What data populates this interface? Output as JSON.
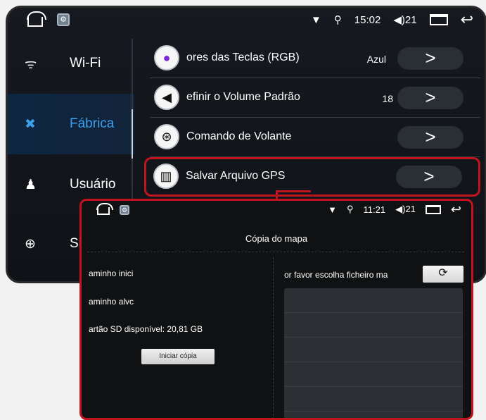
{
  "back_screen": {
    "status": {
      "time": "15:02",
      "volume": "21"
    },
    "sidebar": [
      {
        "label": "Wi-Fi",
        "icon": "wifi-icon"
      },
      {
        "label": "Fábrica",
        "icon": "tools-icon",
        "active": true
      },
      {
        "label": "Usuário",
        "icon": "user-icon"
      },
      {
        "label": "Sist",
        "icon": "globe-icon"
      }
    ],
    "rows": [
      {
        "label": "ores das Teclas (RGB)",
        "value": "Azul",
        "icon": "bulb-icon"
      },
      {
        "label": "efinir o Volume Padrão",
        "value": "18",
        "icon": "speaker-icon"
      },
      {
        "label": "Comando de Volante",
        "value": "",
        "icon": "steering-wheel-icon"
      },
      {
        "label": "Salvar Arquivo GPS",
        "value": "",
        "icon": "map-icon"
      }
    ],
    "arrow": ">"
  },
  "overlay": {
    "status": {
      "time": "11:21",
      "volume": "21"
    },
    "title": "Cópia do mapa",
    "source_path_label": "aminho inici",
    "target_path_label": "aminho alvc",
    "sd_label": "artão SD disponível:",
    "sd_value": "20,81 GB",
    "start_button": "Iniciar cópia",
    "choose_label": "or favor escolha ficheiro ma",
    "refresh_icon": "refresh-icon"
  },
  "accent_color": "#c0141e"
}
